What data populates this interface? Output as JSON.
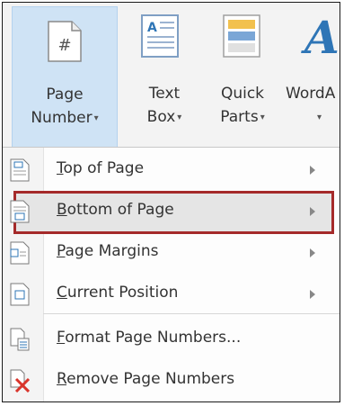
{
  "ribbon": {
    "page_number": {
      "line1": "Page",
      "line2": "Number",
      "caret": "▾"
    },
    "text_box": {
      "line1": "Text",
      "line2": "Box",
      "caret": "▾"
    },
    "quick_parts": {
      "line1": "Quick",
      "line2": "Parts",
      "caret": "▾"
    },
    "wordart": {
      "line1": "WordA",
      "caret": "▾"
    }
  },
  "menu": {
    "items": [
      {
        "access": "T",
        "rest": "op of Page",
        "has_submenu": true
      },
      {
        "access": "B",
        "rest": "ottom of Page",
        "has_submenu": true,
        "highlighted": true
      },
      {
        "access": "P",
        "rest": "age Margins",
        "has_submenu": true
      },
      {
        "access": "C",
        "rest": "urrent Position",
        "has_submenu": true
      },
      {
        "access": "F",
        "rest": "ormat Page Numbers...",
        "has_submenu": false
      },
      {
        "access": "R",
        "rest": "emove Page Numbers",
        "has_submenu": false
      }
    ]
  },
  "colors": {
    "highlight_border": "#a52a2a",
    "accent_blue": "#2e75b6",
    "remove_red": "#d9342b"
  }
}
